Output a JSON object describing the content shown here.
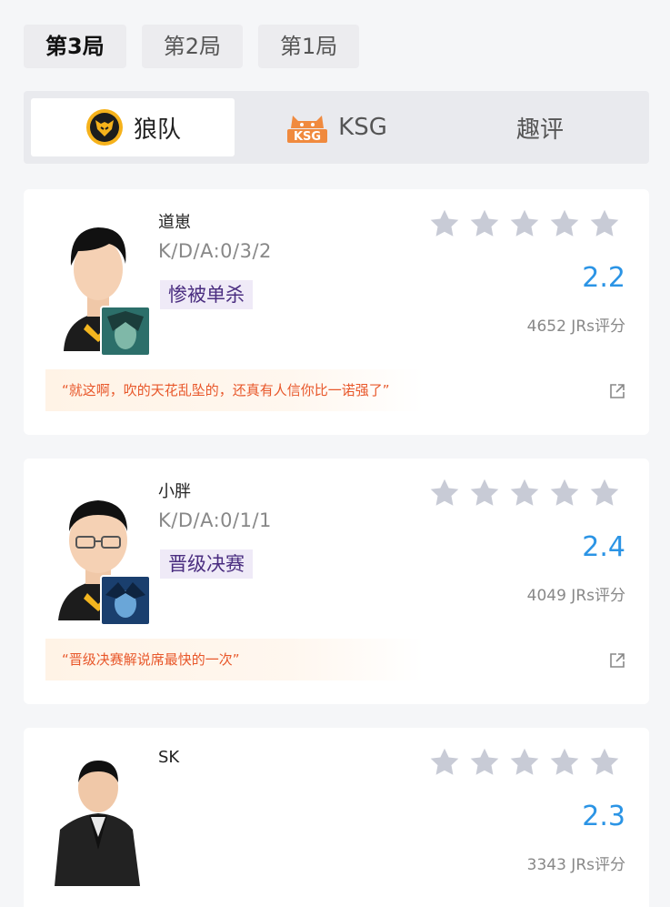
{
  "round_tabs": [
    {
      "label": "第3局"
    },
    {
      "label": "第2局"
    },
    {
      "label": "第1局"
    }
  ],
  "team_tabs": [
    {
      "label": "狼队",
      "icon": "wolves-logo-icon"
    },
    {
      "label": "KSG",
      "icon": "ksg-logo-icon"
    },
    {
      "label": "趣评"
    }
  ],
  "colors": {
    "accent": "#2b94e5",
    "tag_bg": "#efeaf7",
    "tag_text": "#4a2d80",
    "quote_text": "#e8572a",
    "star_empty": "#c8cbd6"
  },
  "players": [
    {
      "name": "道崽",
      "kda": "K/D/A:0/3/2",
      "tag": "惨被单杀",
      "stars_filled": 0,
      "score": "2.2",
      "votes": "4652 JRs评分",
      "quote": "“就这啊，吹的天花乱坠的，还真有人信你比一诺强了”"
    },
    {
      "name": "小胖",
      "kda": "K/D/A:0/1/1",
      "tag": "晋级决赛",
      "stars_filled": 0,
      "score": "2.4",
      "votes": "4049 JRs评分",
      "quote": "“晋级决赛解说席最快的一次”"
    },
    {
      "name": "SK",
      "stars_filled": 0,
      "score": "2.3",
      "votes": "3343 JRs评分"
    }
  ]
}
